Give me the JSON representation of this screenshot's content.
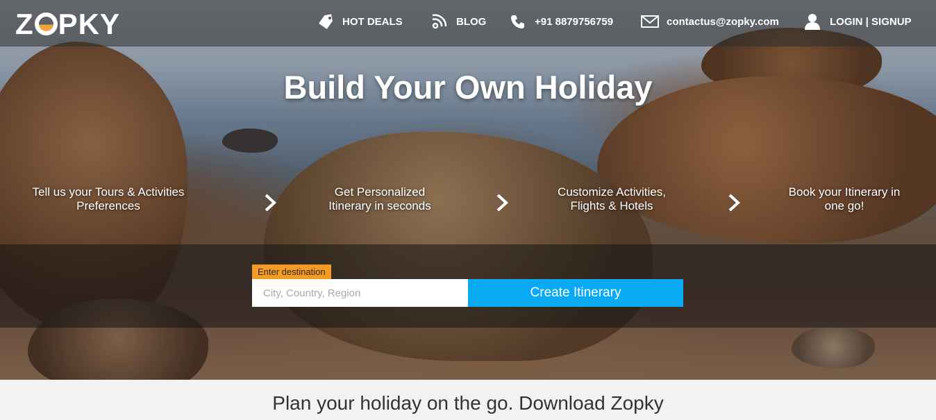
{
  "brand": {
    "logo_left": "Z",
    "logo_right": "PKY"
  },
  "nav": {
    "hot_deals": "HOT DEALS",
    "blog": "BLOG",
    "phone": "+91 8879756759",
    "email": "contactus@zopky.com",
    "login": "LOGIN | SIGNUP"
  },
  "hero": {
    "title": "Build Your Own Holiday",
    "steps": [
      {
        "line1": "Tell us your Tours & Activities",
        "line2": "Preferences"
      },
      {
        "line1": "Get Personalized",
        "line2": "Itinerary in seconds"
      },
      {
        "line1": "Customize Activities,",
        "line2": "Flights & Hotels"
      },
      {
        "line1": "Book your Itinerary in",
        "line2": "one go!"
      }
    ]
  },
  "search": {
    "label": "Enter destination",
    "placeholder": "City, Country, Region",
    "value": "",
    "button": "Create Itinerary"
  },
  "footer": {
    "text": "Plan your holiday on the go. Download Zopky"
  },
  "colors": {
    "accent": "#0aa9f4",
    "label": "#f59a23",
    "logo_ring": "#f2a43a"
  }
}
